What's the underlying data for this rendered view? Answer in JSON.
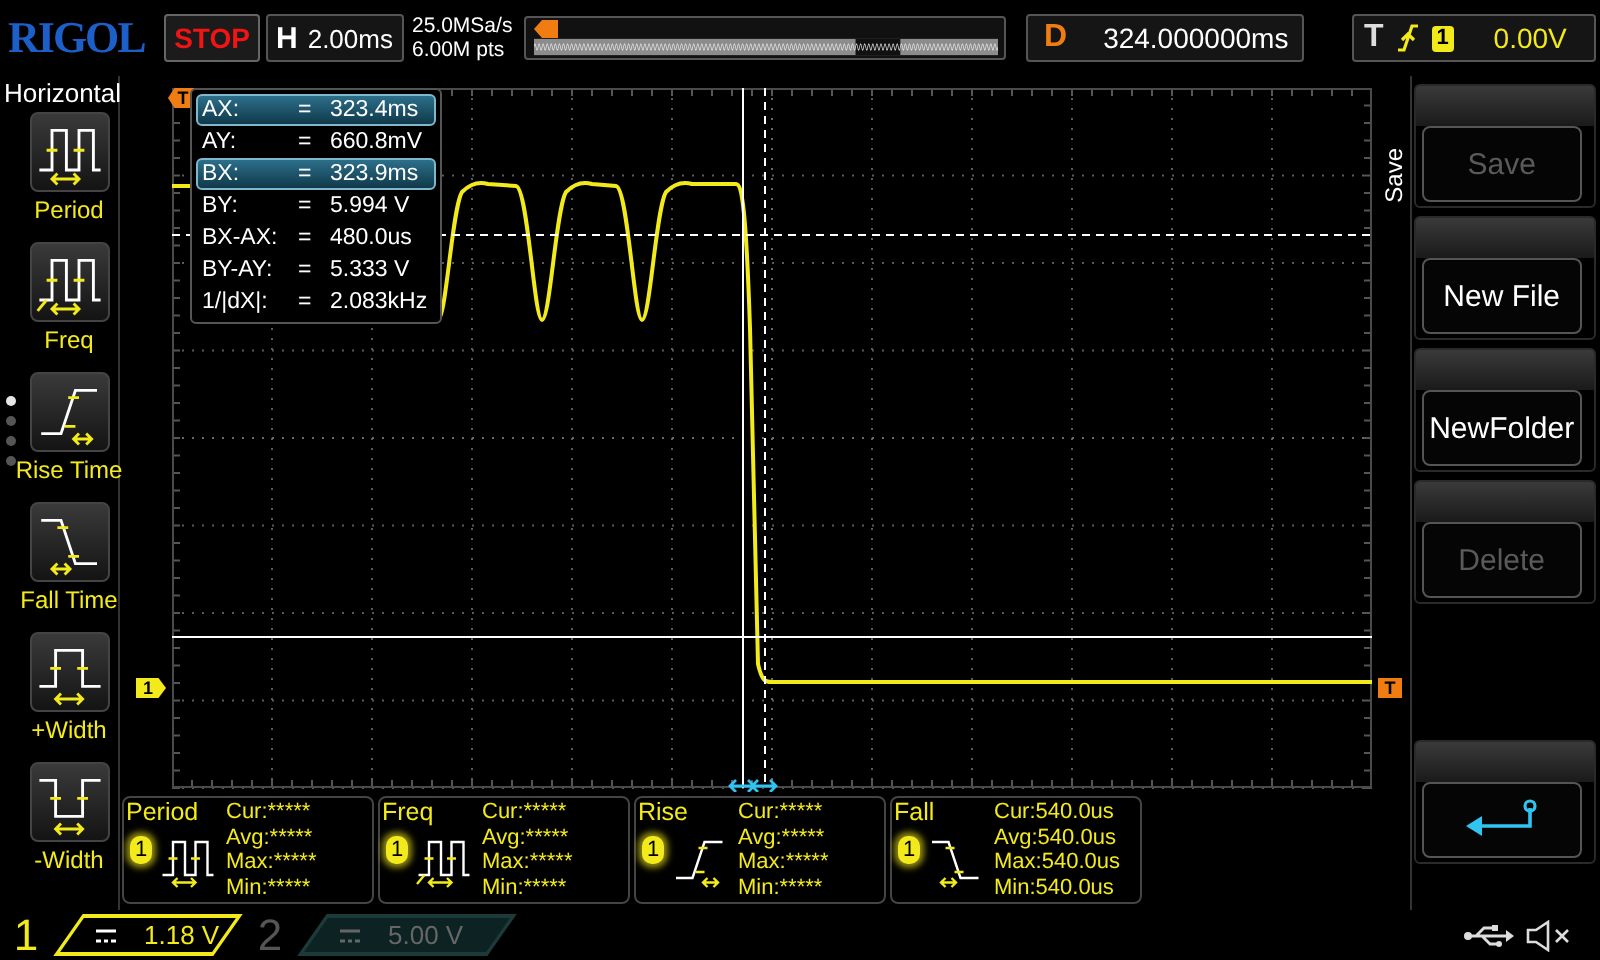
{
  "top_bar": {
    "logo": "RIGOL",
    "run_state": "STOP",
    "timebase": {
      "label": "H",
      "value": "2.00ms"
    },
    "sample_rate": "25.0MSa/s",
    "memory_depth": "6.00M pts",
    "delay": {
      "label": "D",
      "value": "324.000000ms"
    },
    "trigger": {
      "label": "T",
      "source": "1",
      "level": "0.00V"
    }
  },
  "side_menu": {
    "title": "Horizontal",
    "items": [
      {
        "label": "Period",
        "kind": "period"
      },
      {
        "label": "Freq",
        "kind": "freq"
      },
      {
        "label": "Rise Time",
        "kind": "rise"
      },
      {
        "label": "Fall Time",
        "kind": "fall"
      },
      {
        "label": "+Width",
        "kind": "pwidth"
      },
      {
        "label": "-Width",
        "kind": "nwidth"
      }
    ],
    "pages": [
      {
        "selected": true
      },
      {
        "selected": false
      },
      {
        "selected": false
      },
      {
        "selected": false
      }
    ]
  },
  "scope": {
    "trigger_position_marker": "T",
    "channel_marker": "1",
    "trigger_level_marker": "T",
    "cursor_readout": [
      {
        "label": "AX:",
        "equals": "=",
        "value": "323.4ms",
        "selected": true
      },
      {
        "label": "AY:",
        "equals": "=",
        "value": "660.8mV",
        "selected": false
      },
      {
        "label": "BX:",
        "equals": "=",
        "value": "323.9ms",
        "selected": true
      },
      {
        "label": "BY:",
        "equals": "=",
        "value": "5.994 V",
        "selected": false
      },
      {
        "label": "BX-AX:",
        "equals": "=",
        "value": "480.0us",
        "selected": false
      },
      {
        "label": "BY-AY:",
        "equals": "=",
        "value": "5.333 V",
        "selected": false
      },
      {
        "label": "1/|dX|:",
        "equals": "=",
        "value": "2.083kHz",
        "selected": false
      }
    ]
  },
  "measurements": [
    {
      "name": "Period",
      "channel": "1",
      "kind": "period",
      "stats": [
        "Cur:*****",
        "Avg:*****",
        "Max:*****",
        "Min:*****"
      ]
    },
    {
      "name": "Freq",
      "channel": "1",
      "kind": "freq",
      "stats": [
        "Cur:*****",
        "Avg:*****",
        "Max:*****",
        "Min:*****"
      ]
    },
    {
      "name": "Rise",
      "channel": "1",
      "kind": "rise",
      "stats": [
        "Cur:*****",
        "Avg:*****",
        "Max:*****",
        "Min:*****"
      ]
    },
    {
      "name": "Fall",
      "channel": "1",
      "kind": "fall",
      "stats": [
        "Cur:540.0us",
        "Avg:540.0us",
        "Max:540.0us",
        "Min:540.0us"
      ]
    }
  ],
  "right_menu": {
    "title": "Save",
    "buttons": [
      {
        "kind": "text",
        "label": "Save",
        "disabled": true
      },
      {
        "kind": "text",
        "label": "New File",
        "disabled": false
      },
      {
        "kind": "text",
        "label": "NewFolder",
        "disabled": false
      },
      {
        "kind": "text",
        "label": "Delete",
        "disabled": true
      },
      {
        "kind": "back"
      }
    ]
  },
  "bottom_bar": {
    "channels": [
      {
        "number": "1",
        "scale": "1.18 V",
        "on": true
      },
      {
        "number": "2",
        "scale": "5.00 V",
        "on": false
      }
    ]
  }
}
